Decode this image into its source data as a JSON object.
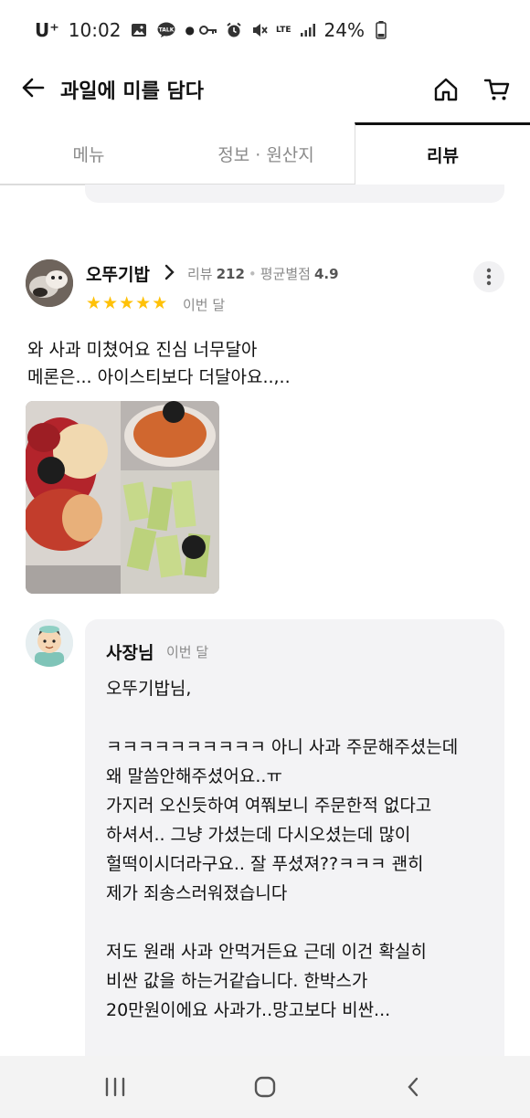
{
  "status_bar": {
    "carrier": "U⁺",
    "time": "10:02",
    "battery": "24%",
    "network": "LTE"
  },
  "header": {
    "title": "과일에 미를 담다"
  },
  "tabs": [
    {
      "label": "메뉴",
      "active": false
    },
    {
      "label": "정보 · 원산지",
      "active": false
    },
    {
      "label": "리뷰",
      "active": true
    }
  ],
  "review": {
    "reviewer_name": "오뚜기밥",
    "review_count_label": "리뷰",
    "review_count": "212",
    "avg_rating_label": "평균별점",
    "avg_rating": "4.9",
    "stars": 5,
    "date": "이번 달",
    "text_line1": "와 사과 미쳤어요 진심 너무달아",
    "text_line2": "메론은... 아이스티보다 더달아요..,.."
  },
  "owner_reply": {
    "name": "사장님",
    "date": "이번 달",
    "text": "오뚜기밥님,\n\nㅋㅋㅋㅋㅋㅋㅋㅋㅋㅋ 아니 사과 주문해주셨는데\n왜 말씀안해주셨어요..ㅠ\n가지러 오신듯하여 여쭤보니 주문한적 없다고\n하셔서.. 그냥 가셨는데 다시오셨는데 많이\n헐떡이시더라구요.. 잘 푸셨져??ㅋㅋㅋ 괜히\n제가 죄송스러워졌습니다\n\n저도 원래 사과 안먹거든요 근데 이건 확실히\n비싼 값을 하는거같습니다. 한박스가\n20만원이에요 사과가..망고보다 비싼..."
  },
  "colors": {
    "star": "#ffc107",
    "reply_bg": "#f3f3f5",
    "muted_text": "#8a8a8a"
  }
}
